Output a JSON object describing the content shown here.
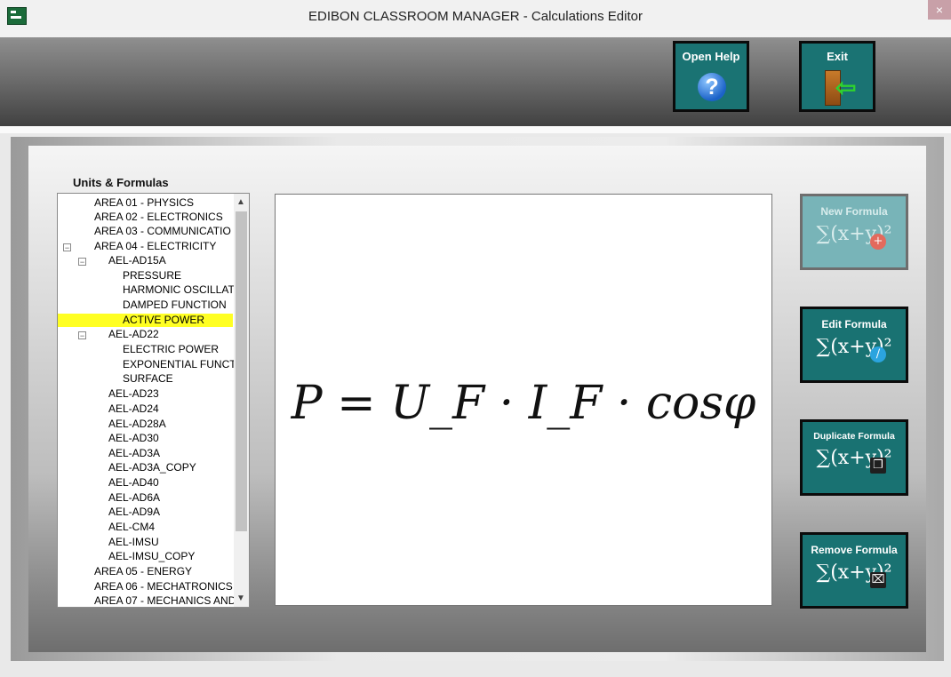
{
  "window": {
    "title": "EDIBON CLASSROOM MANAGER - Calculations Editor",
    "close_glyph": "×"
  },
  "toolbar": {
    "help_label": "Open Help",
    "exit_label": "Exit"
  },
  "units": {
    "title": "Units & Formulas",
    "items": [
      "AREA 01 - PHYSICS",
      "AREA 02 - ELECTRONICS",
      "AREA 03 - COMMUNICATIO",
      "AREA 04 - ELECTRICITY",
      "AEL-AD15A",
      "PRESSURE",
      "HARMONIC OSCILLAT",
      "DAMPED FUNCTION",
      "ACTIVE POWER",
      "AEL-AD22",
      "ELECTRIC POWER",
      "EXPONENTIAL FUNCT",
      "SURFACE",
      "AEL-AD23",
      "AEL-AD24",
      "AEL-AD28A",
      "AEL-AD30",
      "AEL-AD3A",
      "AEL-AD3A_COPY",
      "AEL-AD40",
      "AEL-AD6A",
      "AEL-AD9A",
      "AEL-CM4",
      "AEL-IMSU",
      "AEL-IMSU_COPY",
      "AREA 05 - ENERGY",
      "AREA 06 - MECHATRONICS",
      "AREA 07 - MECHANICS AND"
    ]
  },
  "formula": {
    "expression": "P = U_F · I_F · cosφ"
  },
  "actions": {
    "new_formula": "New Formula",
    "edit_formula": "Edit Formula",
    "duplicate_formula": "Duplicate Formula",
    "remove_formula": "Remove Formula"
  }
}
